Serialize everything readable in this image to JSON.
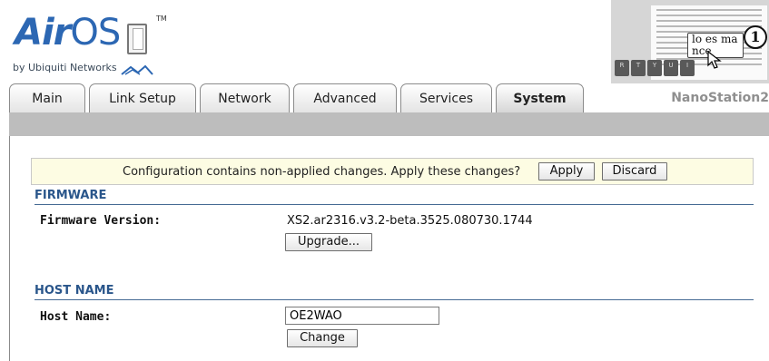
{
  "header": {
    "brand_air": "Air",
    "brand_os": "OS",
    "trademark": "TM",
    "byline": "by Ubiquiti Networks",
    "device_name": "NanoStation2"
  },
  "thumbnail": {
    "keys": [
      "R",
      "T",
      "Y",
      "U",
      "I"
    ],
    "bubble_lines": [
      "lo es ma",
      "nce"
    ],
    "step_number": "1"
  },
  "tabs": [
    {
      "label": "Main",
      "active": false
    },
    {
      "label": "Link Setup",
      "active": false
    },
    {
      "label": "Network",
      "active": false
    },
    {
      "label": "Advanced",
      "active": false
    },
    {
      "label": "Services",
      "active": false
    },
    {
      "label": "System",
      "active": true
    }
  ],
  "notice": {
    "message": "Configuration contains non-applied changes. Apply these changes?",
    "apply_label": "Apply",
    "discard_label": "Discard"
  },
  "firmware": {
    "section_title": "FIRMWARE",
    "version_label": "Firmware Version:",
    "version_value": "XS2.ar2316.v3.2-beta.3525.080730.1744",
    "upgrade_label": "Upgrade..."
  },
  "hostname": {
    "section_title": "HOST NAME",
    "label": "Host Name:",
    "value": "OE2WAO",
    "change_label": "Change"
  },
  "colors": {
    "brand_blue": "#2c67b3",
    "section_blue": "#2a568b",
    "notice_bg": "#fdfce3",
    "bar_gray": "#bdbdbd"
  }
}
